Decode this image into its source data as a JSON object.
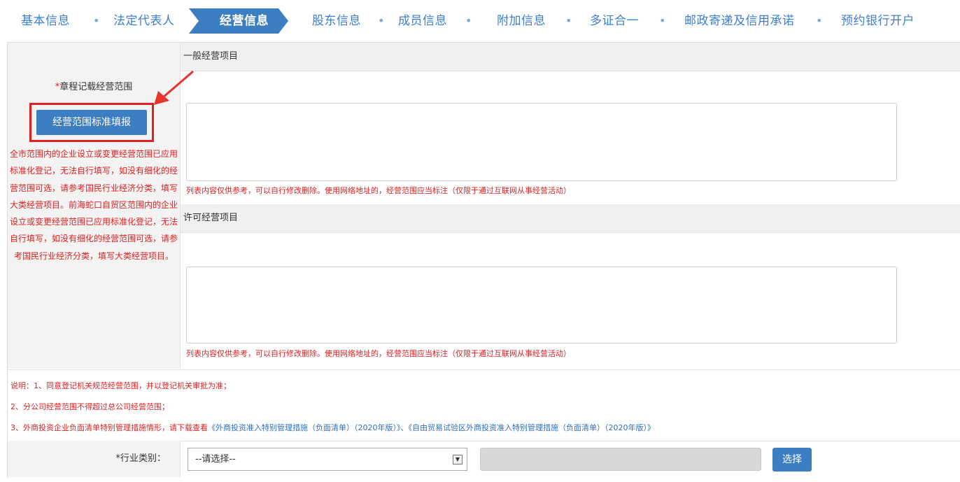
{
  "steps": [
    {
      "label": "基本信息"
    },
    {
      "label": "法定代表人"
    },
    {
      "label": "经营信息"
    },
    {
      "label": "股东信息"
    },
    {
      "label": "成员信息"
    },
    {
      "label": "附加信息"
    },
    {
      "label": "多证合一"
    },
    {
      "label": "邮政寄递及信用承诺"
    },
    {
      "label": "预约银行开户"
    }
  ],
  "step_separator": "•",
  "scope": {
    "required_star": "*",
    "label": "章程记载经营范围",
    "standard_button": "经营范围标准填报",
    "left_note": "全市范围内的企业设立或变更经营范围已应用标准化登记，无法自行填写，如没有细化的经营范围可选，请参考国民行业经济分类，填写大类经营项目。前海蛇口自贸区范围内的企业设立或变更经营范围已应用标准化登记，无法自行填写，如没有细化的经营范围可选，请参考国民行业经济分类，填写大类经营项目。",
    "general_title": "一般经营项目",
    "general_value": "",
    "general_note": "列表内容仅供参考，可以自行修改删除。使用网络地址的，经营范围应当标注（仅限于通过互联网从事经营活动）",
    "license_title": "许可经营项目",
    "license_value": "",
    "license_note": "列表内容仅供参考，可以自行修改删除。使用网络地址的，经营范围应当标注（仅限于通过互联网从事经营活动）"
  },
  "explain": {
    "line1": "说明：1、同意登记机关规范经营范围，并以登记机关审批为准；",
    "line2": "2、分公司经营范围不得超过总公司经营范围；",
    "line3_prefix": "3、外商投资企业负面清单特别管理措施情形，请下载查看",
    "link1": "《外商投资准入特别管理措施（负面清单）（2020年版）》",
    "link_sep": "、",
    "link2": "《自由贸易试验区外商投资准入特别管理措施（负面清单）（2020年版）》"
  },
  "industry": {
    "label": "*行业类别：",
    "select_value": "--请选择--",
    "choose_button": "选择"
  },
  "colors": {
    "accent": "#3c7ec2",
    "step_text": "#3d7fd0",
    "warning_red": "#e02020",
    "annotation_red": "#e8332a"
  },
  "icons": {
    "arrow": "annotation-arrow-icon",
    "select": "dropdown-arrow-icon"
  }
}
